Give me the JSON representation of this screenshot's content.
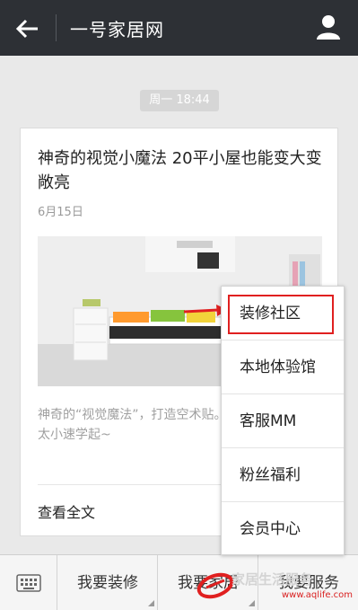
{
  "header": {
    "title": "一号家居网",
    "back_icon": "arrow-left-icon",
    "profile_icon": "person-icon"
  },
  "chat": {
    "timestamp": "周一 18:44"
  },
  "article": {
    "title": "神奇的视觉小魔法 20平小屋也能变大变敞亮",
    "date": "6月15日",
    "summary": "神奇的“视觉魔法”，打造空术贴。嫌自己家的空间太小速学起~",
    "read_more": "查看全文"
  },
  "bottom_menu": {
    "keyboard_icon": "keyboard-icon",
    "items": [
      "我要装修",
      "我要家居",
      "我要服务"
    ]
  },
  "popup_menu": {
    "items": [
      "装修社区",
      "本地体验馆",
      "客服MM",
      "粉丝福利",
      "会员中心"
    ],
    "highlighted_index": 0
  },
  "watermark": {
    "brand": "家居生活服务",
    "url": "www.aqlife.com"
  },
  "colors": {
    "topbar": "#2d3035",
    "highlight_border": "#e02020",
    "background": "#e9e9e9"
  }
}
